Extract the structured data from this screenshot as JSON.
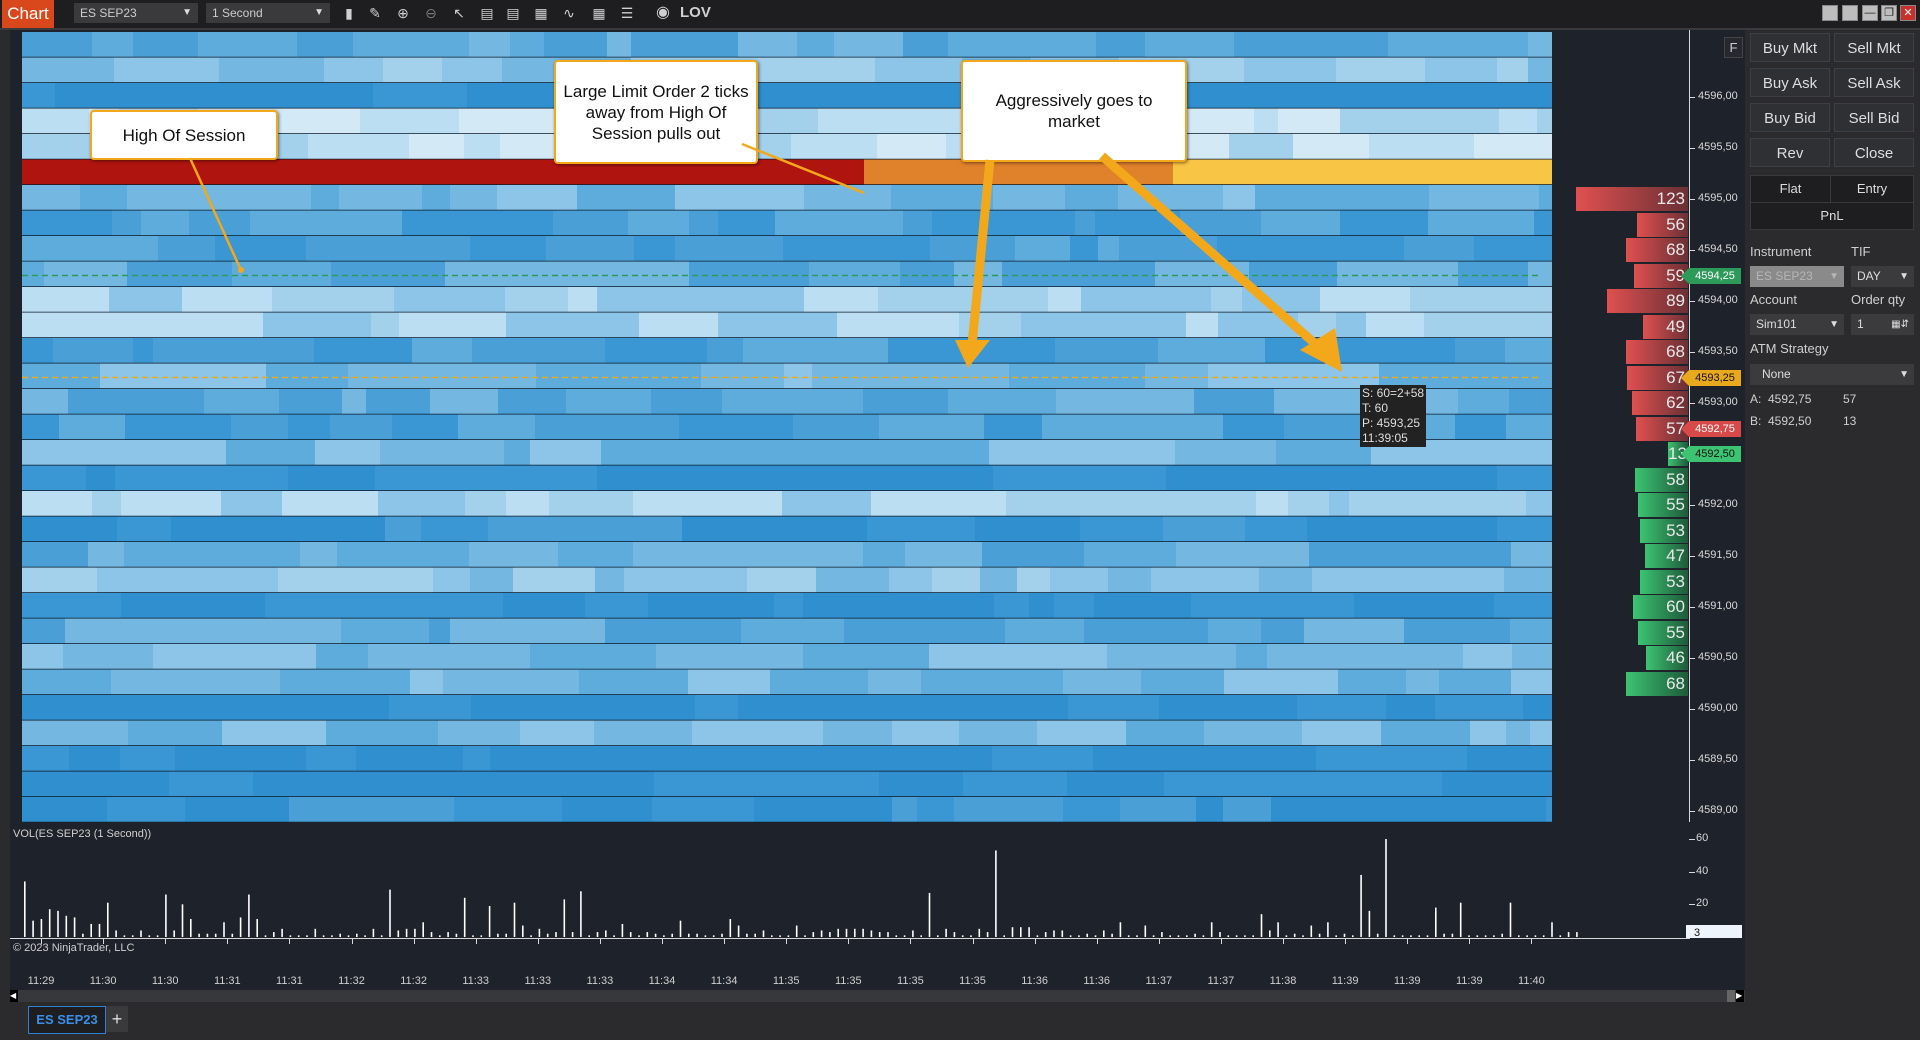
{
  "toolbar": {
    "chart_label": "Chart",
    "instrument": "ES SEP23",
    "interval": "1 Second",
    "lov_label": "LOV",
    "icons": [
      "bar-type-icon",
      "pencil-icon",
      "zoom-in-icon",
      "zoom-out-icon",
      "pointer-icon",
      "data-box-icon",
      "chart-trader-icon",
      "volume-profile-icon",
      "strategies-icon",
      "properties-icon",
      "indicators-list-icon"
    ]
  },
  "annotations": {
    "high_of_session": "High Of Session",
    "large_limit": "Large Limit Order 2 ticks away from High Of Session pulls out",
    "aggressive": "Aggressively goes to market"
  },
  "tooltip": {
    "line1": "S: 60=2+58",
    "line2": "T: 60",
    "line3": "P: 4593,25",
    "line4": "11:39:05"
  },
  "price_axis": {
    "labels": [
      "4596,00",
      "4595,50",
      "4595,00",
      "4594,50",
      "4594,00",
      "4593,50",
      "4593,00",
      "4592,00",
      "4591,50",
      "4591,00",
      "4590,50",
      "4590,00",
      "4589,50",
      "4589,00"
    ],
    "label_prices": [
      4596.0,
      4595.5,
      4595.0,
      4594.5,
      4594.0,
      4593.5,
      4593.0,
      4592.0,
      4591.5,
      4591.0,
      4590.5,
      4590.0,
      4589.5,
      4589.0
    ],
    "flags": [
      {
        "label": "4594,25",
        "price": 4594.25,
        "color": "#2e9a5a",
        "text": "#ffffff"
      },
      {
        "label": "4593,25",
        "price": 4593.25,
        "color": "#e8a91c",
        "text": "#111111"
      },
      {
        "label": "4592,75",
        "price": 4592.75,
        "color": "#d84a4a",
        "text": "#ffffff"
      },
      {
        "label": "4592,50",
        "price": 4592.5,
        "color": "#3cc472",
        "text": "#111111"
      }
    ],
    "f_button": "F"
  },
  "dom": {
    "asks": [
      {
        "price": 4595.0,
        "size": 123
      },
      {
        "price": 4594.75,
        "size": 56
      },
      {
        "price": 4594.5,
        "size": 68
      },
      {
        "price": 4594.25,
        "size": 59
      },
      {
        "price": 4594.0,
        "size": 89
      },
      {
        "price": 4593.75,
        "size": 49
      },
      {
        "price": 4593.5,
        "size": 68
      },
      {
        "price": 4593.25,
        "size": 67
      },
      {
        "price": 4593.0,
        "size": 62
      },
      {
        "price": 4592.75,
        "size": 57
      }
    ],
    "bids": [
      {
        "price": 4592.5,
        "size": 13
      },
      {
        "price": 4592.25,
        "size": 58
      },
      {
        "price": 4592.0,
        "size": 55
      },
      {
        "price": 4591.75,
        "size": 53
      },
      {
        "price": 4591.5,
        "size": 47
      },
      {
        "price": 4591.25,
        "size": 53
      },
      {
        "price": 4591.0,
        "size": 60
      },
      {
        "price": 4590.75,
        "size": 55
      },
      {
        "price": 4590.5,
        "size": 46
      },
      {
        "price": 4590.25,
        "size": 68
      }
    ]
  },
  "panel": {
    "buy_mkt": "Buy Mkt",
    "sell_mkt": "Sell Mkt",
    "buy_ask": "Buy Ask",
    "sell_ask": "Sell Ask",
    "buy_bid": "Buy Bid",
    "sell_bid": "Sell Bid",
    "rev": "Rev",
    "close": "Close",
    "flat": "Flat",
    "entry": "Entry",
    "pnl": "PnL",
    "instrument_label": "Instrument",
    "instrument_value": "ES SEP23",
    "tif_label": "TIF",
    "tif_value": "DAY",
    "account_label": "Account",
    "account_value": "Sim101",
    "qty_label": "Order qty",
    "qty_value": "1",
    "atm_label": "ATM Strategy",
    "atm_value": "None",
    "ask_label": "A:",
    "ask_price": "4592,75",
    "ask_size": "57",
    "bid_label": "B:",
    "bid_price": "4592,50",
    "bid_size": "13"
  },
  "volume": {
    "title": "VOL(ES SEP23 (1 Second))",
    "copyright": "© 2023 NinjaTrader, LLC",
    "axis_labels": [
      "60",
      "40",
      "20"
    ],
    "axis_values": [
      60,
      40,
      20
    ],
    "current": "3",
    "bars": [
      34,
      10,
      11,
      17,
      16,
      13,
      12,
      2,
      8,
      8,
      21,
      4,
      1,
      1,
      4,
      1,
      1,
      26,
      4,
      20,
      11,
      2,
      2,
      2,
      9,
      2,
      12,
      26,
      11,
      1,
      3,
      5,
      1,
      1,
      1,
      5,
      1,
      1,
      2,
      1,
      2,
      1,
      5,
      1,
      29,
      4,
      5,
      5,
      9,
      3,
      1,
      3,
      2,
      24,
      1,
      1,
      19,
      2,
      2,
      21,
      7,
      1,
      5,
      2,
      3,
      23,
      3,
      28,
      1,
      3,
      4,
      1,
      8,
      3,
      1,
      3,
      2,
      1,
      2,
      10,
      2,
      2,
      1,
      1,
      2,
      11,
      7,
      2,
      2,
      4,
      1,
      1,
      1,
      7,
      1,
      3,
      4,
      3,
      5,
      5,
      5,
      5,
      4,
      3,
      3,
      1,
      1,
      4,
      1,
      27,
      1,
      5,
      3,
      1,
      1,
      5,
      3,
      53,
      1,
      6,
      6,
      6,
      1,
      3,
      4,
      4,
      1,
      1,
      2,
      1,
      4,
      2,
      9,
      1,
      1,
      7,
      1,
      3,
      1,
      1,
      1,
      2,
      1,
      9,
      3,
      1,
      1,
      1,
      1,
      14,
      4,
      9,
      1,
      2,
      1,
      7,
      2,
      9,
      1,
      2,
      1,
      38,
      16,
      2,
      60,
      1,
      1,
      1,
      1,
      1,
      18,
      2,
      2,
      21,
      1,
      1,
      1,
      1,
      2,
      21,
      1,
      1,
      1,
      1,
      9,
      1,
      3,
      3
    ]
  },
  "time_axis": {
    "labels": [
      "11:29",
      "11:30",
      "11:30",
      "11:31",
      "11:31",
      "11:32",
      "11:32",
      "11:33",
      "11:33",
      "11:33",
      "11:34",
      "11:34",
      "11:35",
      "11:35",
      "11:35",
      "11:35",
      "11:36",
      "11:36",
      "11:37",
      "11:37",
      "11:38",
      "11:39",
      "11:39",
      "11:39",
      "11:40"
    ]
  },
  "tabs": {
    "active": "ES SEP23",
    "add": "+"
  },
  "colors": {
    "accent": "#d9481c",
    "ask_red": "#d84a4a",
    "bid_green": "#3cc472",
    "annotation_border": "#f2a81a",
    "tab_blue": "#2f7fd6"
  }
}
